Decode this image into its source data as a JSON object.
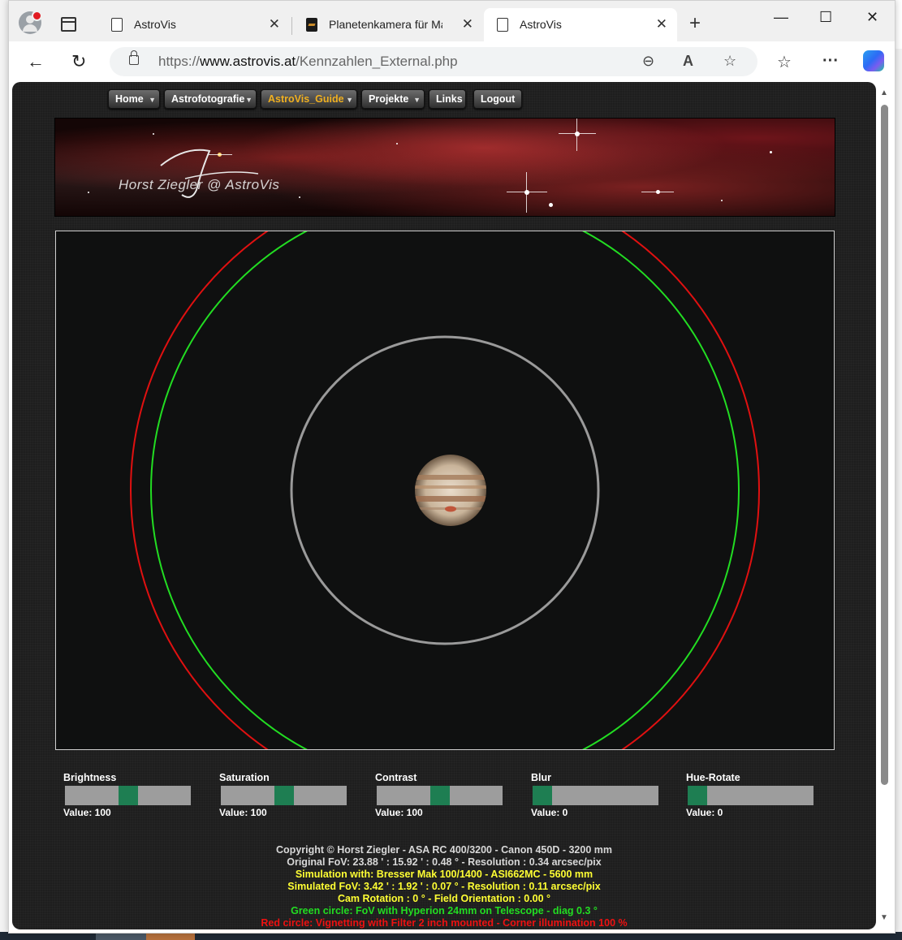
{
  "browser": {
    "tabs": [
      {
        "title": "AstroVis",
        "active": false
      },
      {
        "title": "Planetenkamera für Mal",
        "active": false
      },
      {
        "title": "AstroVis",
        "active": true
      }
    ],
    "close_glyph": "✕",
    "new_tab_glyph": "+",
    "window_controls": {
      "minimize": "—",
      "maximize": "☐",
      "close": "✕"
    },
    "nav": {
      "back": "←",
      "reload": "↻"
    },
    "url_prefix": "https://",
    "url_domain": "www.astrovis.at",
    "url_path": "/Kennzahlen_External.php",
    "url_icons": {
      "zoom": "⊖",
      "read_aloud": "A",
      "favorite": "☆"
    },
    "toolbar_icons": {
      "favorites": "☆",
      "more": "···"
    }
  },
  "site": {
    "menu": [
      {
        "label": "Home",
        "has_dropdown": true,
        "selected": false
      },
      {
        "label": "Astrofotografie",
        "has_dropdown": true,
        "selected": false
      },
      {
        "label": "AstroVis_Guide",
        "has_dropdown": true,
        "selected": true
      },
      {
        "label": "Projekte",
        "has_dropdown": true,
        "selected": false
      },
      {
        "label": "Links",
        "has_dropdown": false,
        "selected": false
      },
      {
        "label": "Logout",
        "has_dropdown": false,
        "selected": false
      }
    ],
    "dropdown_glyph": "▼",
    "banner_signature": "Horst Ziegler @ AstroVis",
    "sliders": [
      {
        "label": "Brightness",
        "value_text": "Value: 100",
        "level": 0.5
      },
      {
        "label": "Saturation",
        "value_text": "Value: 100",
        "level": 0.5
      },
      {
        "label": "Contrast",
        "value_text": "Value: 100",
        "level": 0.5
      },
      {
        "label": "Blur",
        "value_text": "Value: 0",
        "level": 0.0
      },
      {
        "label": "Hue-Rotate",
        "value_text": "Value: 0",
        "level": 0.0
      }
    ],
    "footer": [
      {
        "text": "Copyright © Horst Ziegler - ASA RC 400/3200 - Canon 450D - 3200 mm",
        "color": "#d8d8d8"
      },
      {
        "text": "Original FoV: 23.88 ' : 15.92 ' : 0.48 ° - Resolution : 0.34 arcsec/pix",
        "color": "#d8d8d8"
      },
      {
        "text": "Simulation with: Bresser Mak 100/1400 - ASI662MC - 5600 mm",
        "color": "#ffff33"
      },
      {
        "text": "Simulated FoV: 3.42 ' : 1.92 ' : 0.07 ° - Resolution : 0.11 arcsec/pix",
        "color": "#ffff33"
      },
      {
        "text": "Cam Rotation : 0 ° - Field Orientation : 0.00 °",
        "color": "#ffff33"
      },
      {
        "text": "Green circle: FoV with Hyperion 24mm on Telescope - diag 0.3 °",
        "color": "#22dd22"
      },
      {
        "text": "Red circle: Vignetting with Filter 2 inch mounted - Corner illumination 100 %",
        "color": "#ee1111"
      }
    ],
    "colors": {
      "menu_selected": "#f0b020",
      "slider_thumb": "#1e7e52",
      "circle_red": "#e01010",
      "circle_green": "#22dd22",
      "circle_gray": "#9a9a9a"
    }
  }
}
